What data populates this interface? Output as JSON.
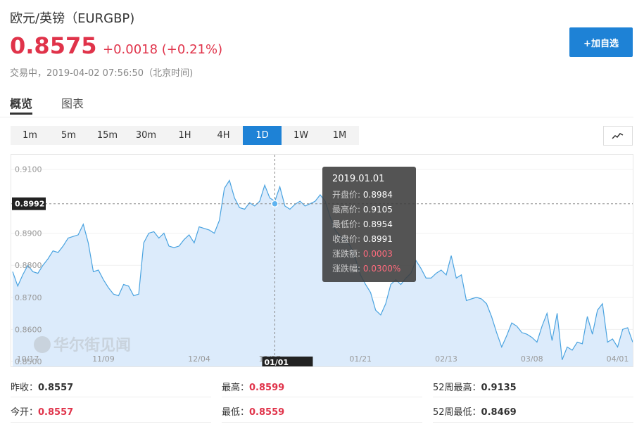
{
  "header": {
    "title": "欧元/英镑（EURGBP)",
    "price": "0.8575",
    "change": "+0.0018 (+0.21%)",
    "status": "交易中，2019-04-02 07:56:50（北京时间)",
    "add_button": "+加自选"
  },
  "tabs": [
    {
      "label": "概览",
      "active": true
    },
    {
      "label": "图表",
      "active": false
    }
  ],
  "periods": [
    {
      "label": "1m"
    },
    {
      "label": "5m"
    },
    {
      "label": "15m"
    },
    {
      "label": "30m"
    },
    {
      "label": "1H"
    },
    {
      "label": "4H"
    },
    {
      "label": "1D",
      "active": true
    },
    {
      "label": "1W"
    },
    {
      "label": "1M"
    }
  ],
  "chart_type_icon": "line-chart-icon",
  "watermark": "华尔街见闻",
  "tooltip": {
    "date": "2019.01.01",
    "open_label": "开盘价:",
    "open": "0.8984",
    "high_label": "最高价:",
    "high": "0.9105",
    "low_label": "最低价:",
    "low": "0.8954",
    "close_label": "收盘价:",
    "close": "0.8991",
    "change_label": "涨跌额:",
    "change": "0.0003",
    "pct_label": "涨跌幅:",
    "pct": "0.0300%"
  },
  "crosshair": {
    "value_label": "0.8992",
    "date_label": "01/01",
    "x_index": 52,
    "value": 0.8992
  },
  "stats": {
    "prev_close_label": "昨收：",
    "prev_close": "0.8557",
    "open_label": "今开：",
    "open": "0.8557",
    "high_label": "最高：",
    "high": "0.8599",
    "low_label": "最低：",
    "low": "0.8559",
    "wk52_high_label": "52周最高：",
    "wk52_high": "0.9135",
    "wk52_low_label": "52周最低：",
    "wk52_low": "0.8469"
  },
  "colors": {
    "accent": "#1e82d6",
    "up": "#e0334a",
    "area": "#dcebfb",
    "line": "#4aa3e0"
  },
  "chart_data": {
    "type": "area",
    "title": "",
    "xlabel": "",
    "ylabel": "",
    "ylim": [
      0.848,
      0.9145
    ],
    "yticks": [
      "0.8500",
      "0.8600",
      "0.8700",
      "0.8800",
      "0.8900",
      "0.9100"
    ],
    "ytick_values": [
      0.85,
      0.86,
      0.87,
      0.88,
      0.89,
      0.91
    ],
    "xticks": [
      {
        "label": "10/17",
        "index": 3
      },
      {
        "label": "11/09",
        "index": 18
      },
      {
        "label": "12/04",
        "index": 37
      },
      {
        "label": "12/27",
        "index": 51
      },
      {
        "label": "01/21",
        "index": 69
      },
      {
        "label": "02/13",
        "index": 86
      },
      {
        "label": "03/08",
        "index": 103
      },
      {
        "label": "04/01",
        "index": 120
      }
    ],
    "grid": true,
    "series": [
      {
        "values": [
          0.878,
          0.8735,
          0.877,
          0.88,
          0.878,
          0.8775,
          0.88,
          0.882,
          0.8845,
          0.884,
          0.886,
          0.8885,
          0.889,
          0.8895,
          0.8928,
          0.887,
          0.878,
          0.8785,
          0.8755,
          0.873,
          0.871,
          0.8705,
          0.874,
          0.8735,
          0.8705,
          0.871,
          0.887,
          0.89,
          0.8905,
          0.8885,
          0.89,
          0.886,
          0.8855,
          0.886,
          0.888,
          0.8895,
          0.887,
          0.892,
          0.8915,
          0.891,
          0.89,
          0.894,
          0.904,
          0.9065,
          0.901,
          0.898,
          0.8975,
          0.8995,
          0.8985,
          0.9,
          0.905,
          0.901,
          0.9,
          0.9045,
          0.8985,
          0.8975,
          0.899,
          0.9,
          0.8985,
          0.8992,
          0.9,
          0.902,
          0.9,
          0.895,
          0.891,
          0.889,
          0.888,
          0.886,
          0.882,
          0.877,
          0.874,
          0.8715,
          0.866,
          0.8645,
          0.868,
          0.874,
          0.8755,
          0.874,
          0.876,
          0.8775,
          0.8815,
          0.879,
          0.876,
          0.876,
          0.8775,
          0.8785,
          0.877,
          0.883,
          0.876,
          0.877,
          0.869,
          0.8695,
          0.87,
          0.8695,
          0.868,
          0.864,
          0.859,
          0.8545,
          0.858,
          0.862,
          0.861,
          0.859,
          0.8585,
          0.8575,
          0.856,
          0.861,
          0.865,
          0.8565,
          0.865,
          0.8505,
          0.8545,
          0.8535,
          0.856,
          0.8555,
          0.864,
          0.8585,
          0.866,
          0.868,
          0.856,
          0.857,
          0.8545,
          0.86,
          0.8605,
          0.856
        ]
      }
    ]
  }
}
